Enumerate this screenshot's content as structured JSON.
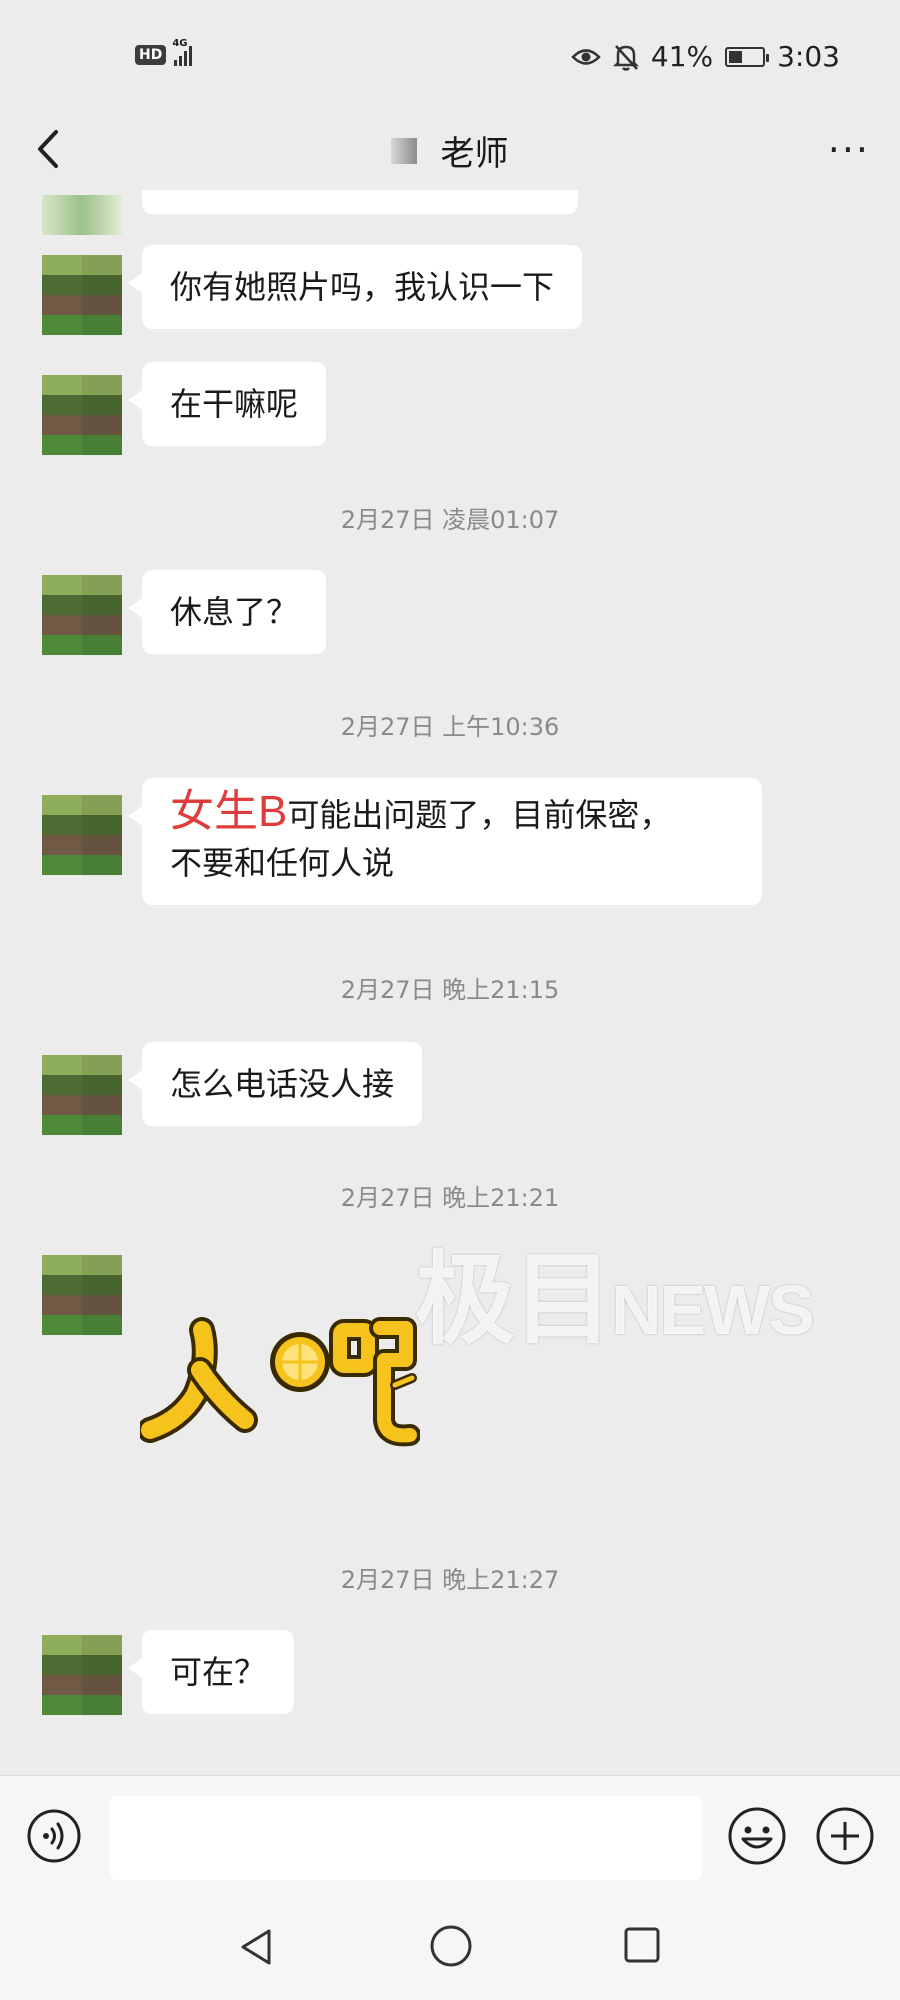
{
  "status_bar": {
    "hd": "HD",
    "network": "4G",
    "battery_percent": "41%",
    "battery_level": 0.41,
    "time": "3:03",
    "icons": [
      "eye-icon",
      "bell-off-icon",
      "battery-icon"
    ]
  },
  "header": {
    "title": "老师",
    "back_icon": "chevron-left-icon",
    "more_icon": "more-icon",
    "more_label": "···"
  },
  "messages": [
    {
      "type": "text",
      "text": "你有她照片吗，我认识一下"
    },
    {
      "type": "text",
      "text": "在干嘛呢"
    },
    {
      "type": "timestamp",
      "text": "2月27日 凌晨01:07"
    },
    {
      "type": "text",
      "text": "休息了？"
    },
    {
      "type": "timestamp",
      "text": "2月27日 上午10:36"
    },
    {
      "type": "annotated_text",
      "label": "女生B",
      "text": "可能出问题了，目前保密，",
      "text2": "不要和任何人说",
      "label_color": "#e03c3c"
    },
    {
      "type": "timestamp",
      "text": "2月27日 晚上21:15"
    },
    {
      "type": "text",
      "text": "怎么电话没人接"
    },
    {
      "type": "timestamp",
      "text": "2月27日 晚上21:21"
    },
    {
      "type": "sticker",
      "text": "人呢"
    },
    {
      "type": "timestamp",
      "text": "2月27日 晚上21:27"
    },
    {
      "type": "text",
      "text": "可在？"
    }
  ],
  "watermark": {
    "cn": "极目",
    "en": "NEWS"
  },
  "input_bar": {
    "voice_icon": "voice-icon",
    "emoji_icon": "emoji-icon",
    "plus_icon": "plus-icon",
    "value": ""
  },
  "nav_bar": {
    "icons": [
      "nav-back-icon",
      "nav-home-icon",
      "nav-recent-icon"
    ]
  },
  "colors": {
    "background": "#ececec",
    "bubble": "#ffffff",
    "timestamp": "#8a8a8a",
    "annotation": "#e03c3c",
    "sticker_yellow": "#f6c21c"
  }
}
